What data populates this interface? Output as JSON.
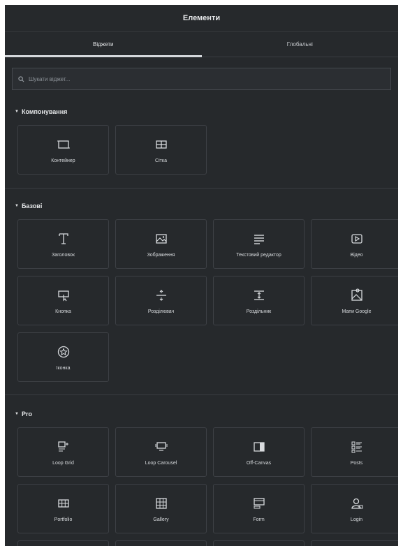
{
  "panel": {
    "title": "Елементи"
  },
  "tabs": [
    {
      "label": "Віджети"
    },
    {
      "label": "Глобальні"
    }
  ],
  "search": {
    "placeholder": "Шукати віджет..."
  },
  "sections": [
    {
      "title": "Компонування",
      "items": [
        {
          "label": "Контейнер",
          "icon": "container-icon"
        },
        {
          "label": "Сітка",
          "icon": "grid-icon"
        }
      ]
    },
    {
      "title": "Базові",
      "items": [
        {
          "label": "Заголовок",
          "icon": "heading-icon"
        },
        {
          "label": "Зображення",
          "icon": "image-icon"
        },
        {
          "label": "Текстовий редактор",
          "icon": "text-editor-icon"
        },
        {
          "label": "Відео",
          "icon": "video-icon"
        },
        {
          "label": "Кнопка",
          "icon": "button-icon"
        },
        {
          "label": "Розділювач",
          "icon": "divider-icon"
        },
        {
          "label": "Роздільник",
          "icon": "spacer-icon"
        },
        {
          "label": "Мапи Google",
          "icon": "google-maps-icon"
        },
        {
          "label": "Іконка",
          "icon": "star-icon"
        }
      ]
    },
    {
      "title": "Pro",
      "items": [
        {
          "label": "Loop Grid",
          "icon": "loop-grid-icon"
        },
        {
          "label": "Loop Carousel",
          "icon": "loop-carousel-icon"
        },
        {
          "label": "Off-Canvas",
          "icon": "off-canvas-icon"
        },
        {
          "label": "Posts",
          "icon": "posts-icon"
        },
        {
          "label": "Portfolio",
          "icon": "portfolio-icon"
        },
        {
          "label": "Gallery",
          "icon": "gallery-icon"
        },
        {
          "label": "Form",
          "icon": "form-icon"
        },
        {
          "label": "Login",
          "icon": "login-icon"
        }
      ]
    }
  ],
  "colors": {
    "background": "#26292c",
    "border": "#3d4045",
    "text": "#d8dbde"
  }
}
